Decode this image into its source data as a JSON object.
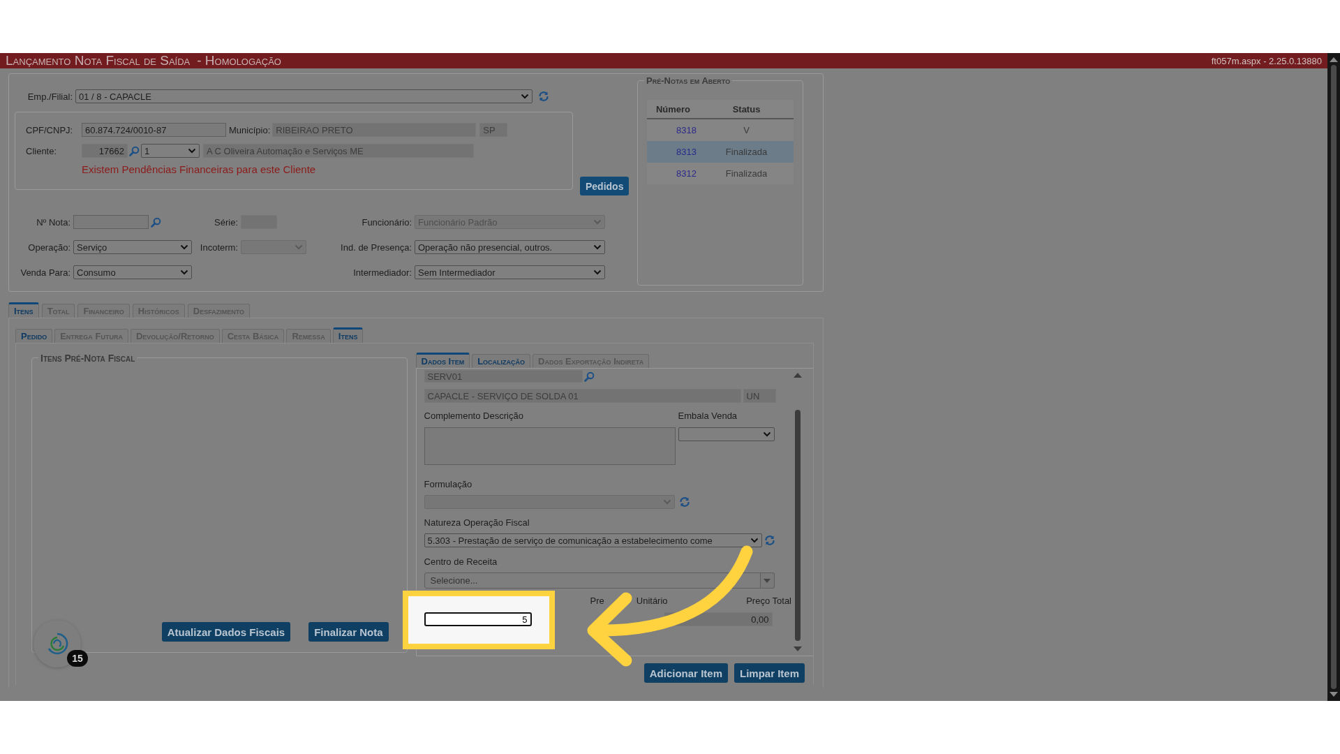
{
  "header": {
    "title": "Lançamento Nota Fiscal de Saída",
    "environment": "- Homologação",
    "version": "ft057m.aspx - 2.25.0.13880"
  },
  "form": {
    "emp_filial": {
      "label": "Emp./Filial:",
      "value": "01 / 8 - CAPACLE"
    },
    "cpf_cnpj": {
      "label": "CPF/CNPJ:",
      "value": "60.874.724/0010-87"
    },
    "municipio": {
      "label": "Município:",
      "value": "RIBEIRAO PRETO",
      "uf": "SP"
    },
    "cliente": {
      "label": "Cliente:",
      "code": "17662",
      "seq": "1",
      "name": "A C Oliveira Automação e Serviços ME"
    },
    "warning": "Existem Pendências Financeiras para este Cliente",
    "pedidos_button": "Pedidos",
    "nota": {
      "label": "Nº Nota:"
    },
    "serie": {
      "label": "Série:"
    },
    "funcionario": {
      "label": "Funcionário:",
      "value": "Funcionário Padrão",
      "disabled": true
    },
    "operacao": {
      "label": "Operação:",
      "value": "Serviço",
      "disabled": false
    },
    "incoterm": {
      "label": "Incoterm:",
      "disabled": true
    },
    "ind_presenca": {
      "label": "Ind. de Presença:",
      "value": "Operação não presencial, outros.",
      "disabled": false
    },
    "venda_para": {
      "label": "Venda Para:",
      "value": "Consumo",
      "disabled": false
    },
    "intermediador": {
      "label": "Intermediador:",
      "value": "Sem Intermediador",
      "disabled": false
    }
  },
  "pre_notas": {
    "title": "Pré-Notas em Aberto",
    "columns": [
      "Número",
      "Status"
    ],
    "rows": [
      {
        "numero": "8318",
        "status": "V",
        "selected": false
      },
      {
        "numero": "8313",
        "status": "Finalizada",
        "selected": true
      },
      {
        "numero": "8312",
        "status": "Finalizada",
        "selected": false
      }
    ]
  },
  "tabs": [
    {
      "label": "Itens",
      "selected": true,
      "disabled": false
    },
    {
      "label": "Total",
      "selected": false,
      "disabled": true
    },
    {
      "label": "Financeiro",
      "selected": false,
      "disabled": true
    },
    {
      "label": "Históricos",
      "selected": false,
      "disabled": true
    },
    {
      "label": "Desfazimento",
      "selected": false,
      "disabled": true
    }
  ],
  "sub_tabs": [
    {
      "label": "Pedido",
      "selected": false,
      "disabled": false
    },
    {
      "label": "Entrega Futura",
      "selected": false,
      "disabled": true
    },
    {
      "label": "Devolução/Retorno",
      "selected": false,
      "disabled": true
    },
    {
      "label": "Cesta Básica",
      "selected": false,
      "disabled": true
    },
    {
      "label": "Remessa",
      "selected": false,
      "disabled": true
    },
    {
      "label": "Itens",
      "selected": true,
      "disabled": false
    }
  ],
  "items_panel": {
    "title": "Itens Pré-Nota Fiscal",
    "buttons": [
      "Atualizar Dados Fiscais",
      "Finalizar Nota"
    ]
  },
  "chat_widget": {
    "badge": "15"
  },
  "item_tabs": [
    {
      "label": "Dados Item",
      "selected": true,
      "disabled": false
    },
    {
      "label": "Localização",
      "selected": false,
      "disabled": false
    },
    {
      "label": "Dados Exportação Indireta",
      "selected": false,
      "disabled": true
    }
  ],
  "item_form": {
    "code": "SERV01",
    "description": "CAPACLE - SERVIÇO DE SOLDA 01",
    "unit": "UN",
    "complemento_label": "Complemento Descrição",
    "embala_label": "Embala Venda",
    "formulacao_label": "Formulação",
    "formulacao_disabled": true,
    "natureza_label": "Natureza Operação Fiscal",
    "natureza_value": "5.303 - Prestação de serviço de comunicação a estabelecimento come",
    "centro_label": "Centro de Receita",
    "centro_placeholder": "Selecione...",
    "preco_unitario_label": [
      "Pre",
      "Unitário"
    ],
    "preco_total_label": "Preço Total",
    "quantidade": "5",
    "preco_total": "0,00"
  },
  "item_buttons": [
    "Adicionar Item",
    "Limpar Item"
  ]
}
